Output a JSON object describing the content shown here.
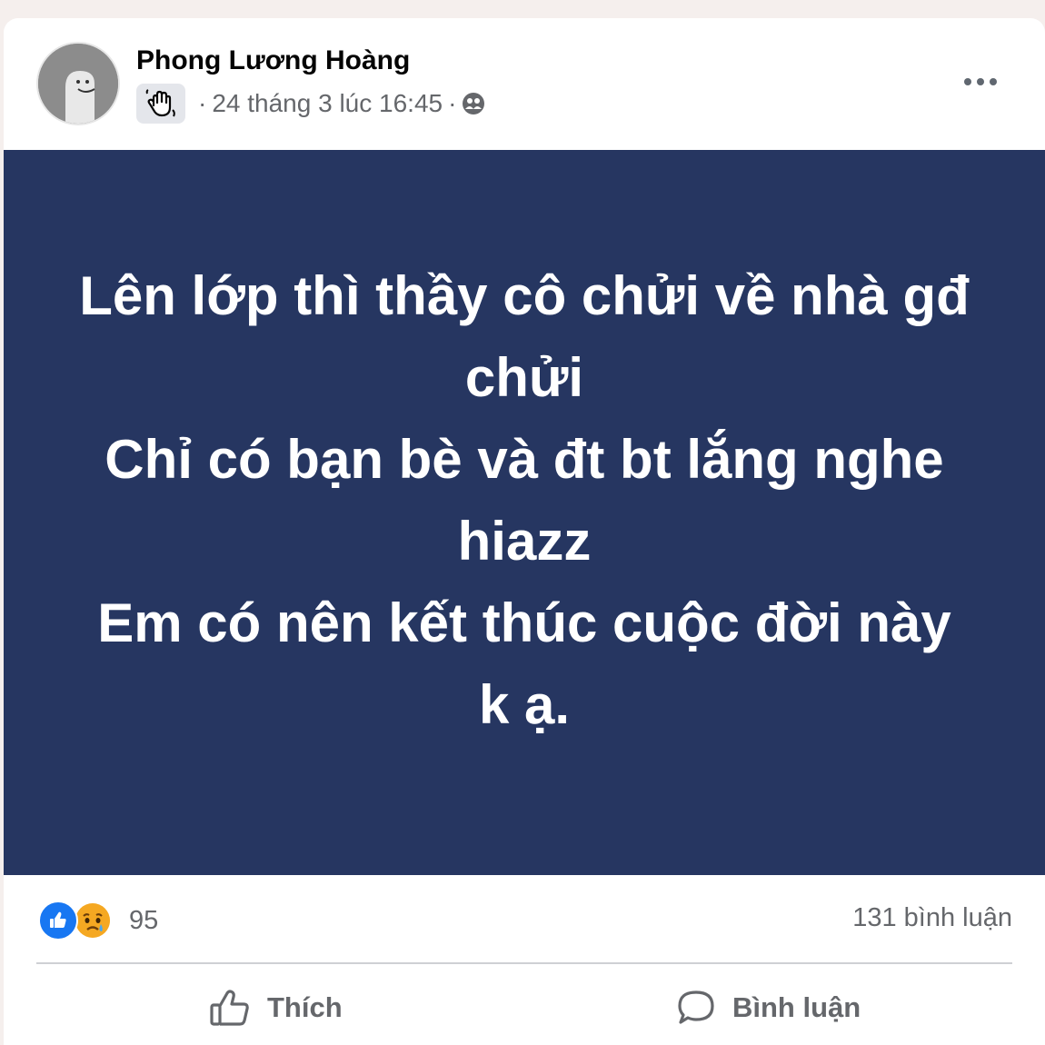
{
  "post": {
    "author_name": "Phong Lương Hoàng",
    "badge_icon": "waving-hand-icon",
    "timestamp": "24 tháng 3 lúc 16:45",
    "separator": "·",
    "audience_icon": "friends-audience-icon",
    "more_icon": "more-options-icon",
    "background_color": "#263661",
    "text": "Lên lớp thì thầy cô chửi về nhà gđ chửi\nChỉ có bạn bè và đt bt lắng nghe hiazz\nEm có nên kết thúc cuộc đời này k ạ."
  },
  "reactions": {
    "icons": [
      "like-reaction-icon",
      "sad-reaction-icon"
    ],
    "count": "95",
    "comments": "131 bình luận"
  },
  "actions": {
    "like_label": "Thích",
    "like_icon": "thumbs-up-icon",
    "comment_label": "Bình luận",
    "comment_icon": "comment-bubble-icon"
  }
}
